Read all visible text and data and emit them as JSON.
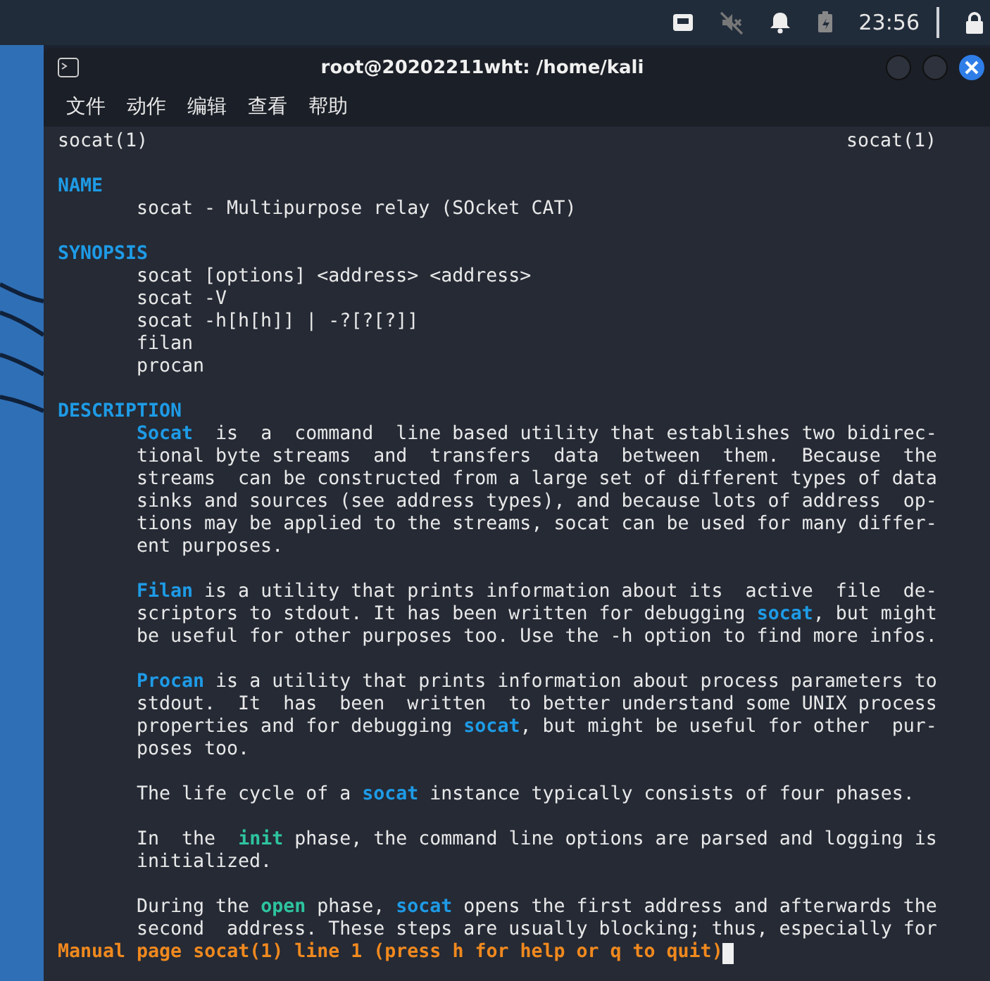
{
  "panel": {
    "clock": "23:56"
  },
  "window": {
    "title": "root@20202211wht: /home/kali"
  },
  "menu": [
    "文件",
    "动作",
    "编辑",
    "查看",
    "帮助"
  ],
  "man": {
    "header_left": "socat(1)",
    "header_right": "socat(1)",
    "sections": [
      {
        "heading": "NAME",
        "paragraphs": [
          [
            [
              {
                "text": "socat - Multipurpose relay (SOcket CAT)",
                "kind": "plain"
              }
            ]
          ]
        ]
      },
      {
        "heading": "SYNOPSIS",
        "paragraphs": [
          [
            [
              {
                "text": "socat [options] <address> <address>",
                "kind": "plain"
              }
            ],
            [
              {
                "text": "socat -V",
                "kind": "plain"
              }
            ],
            [
              {
                "text": "socat -h[h[h]] | -?[?[?]]",
                "kind": "plain"
              }
            ],
            [
              {
                "text": "filan",
                "kind": "plain"
              }
            ],
            [
              {
                "text": "procan",
                "kind": "plain"
              }
            ]
          ]
        ]
      },
      {
        "heading": "DESCRIPTION",
        "paragraphs": [
          [
            [
              {
                "text": "Socat",
                "kind": "command"
              },
              {
                "text": "  is  a  command  line based utility that establishes two bidirec-",
                "kind": "plain"
              }
            ],
            [
              {
                "text": "tional byte streams  and  transfers  data  between  them.  Because  the",
                "kind": "plain"
              }
            ],
            [
              {
                "text": "streams  can be constructed from a large set of different types of data",
                "kind": "plain"
              }
            ],
            [
              {
                "text": "sinks and sources (see address types), and because lots of address  op-",
                "kind": "plain"
              }
            ],
            [
              {
                "text": "tions may be applied to the streams, socat can be used for many differ-",
                "kind": "plain"
              }
            ],
            [
              {
                "text": "ent purposes.",
                "kind": "plain"
              }
            ]
          ],
          [
            [
              {
                "text": "Filan",
                "kind": "command"
              },
              {
                "text": " is a utility that prints information about its  active  file  de-",
                "kind": "plain"
              }
            ],
            [
              {
                "text": "scriptors to stdout. It has been written for debugging ",
                "kind": "plain"
              },
              {
                "text": "socat",
                "kind": "command"
              },
              {
                "text": ", but might",
                "kind": "plain"
              }
            ],
            [
              {
                "text": "be useful for other purposes too. Use the -h option to find more infos.",
                "kind": "plain"
              }
            ]
          ],
          [
            [
              {
                "text": "Procan",
                "kind": "command"
              },
              {
                "text": " is a utility that prints information about process parameters to",
                "kind": "plain"
              }
            ],
            [
              {
                "text": "stdout.  It  has  been  written  to better understand some UNIX process",
                "kind": "plain"
              }
            ],
            [
              {
                "text": "properties and for debugging ",
                "kind": "plain"
              },
              {
                "text": "socat",
                "kind": "command"
              },
              {
                "text": ", but might be useful for other  pur-",
                "kind": "plain"
              }
            ],
            [
              {
                "text": "poses too.",
                "kind": "plain"
              }
            ]
          ],
          [
            [
              {
                "text": "The life cycle of a ",
                "kind": "plain"
              },
              {
                "text": "socat",
                "kind": "command"
              },
              {
                "text": " instance typically consists of four phases.",
                "kind": "plain"
              }
            ]
          ],
          [
            [
              {
                "text": "In  the  ",
                "kind": "plain"
              },
              {
                "text": "init",
                "kind": "keyword"
              },
              {
                "text": " phase, the command line options are parsed and logging is",
                "kind": "plain"
              }
            ],
            [
              {
                "text": "initialized.",
                "kind": "plain"
              }
            ]
          ],
          [
            [
              {
                "text": "During the ",
                "kind": "plain"
              },
              {
                "text": "open",
                "kind": "keyword"
              },
              {
                "text": " phase, ",
                "kind": "plain"
              },
              {
                "text": "socat",
                "kind": "command"
              },
              {
                "text": " opens the first address and afterwards the",
                "kind": "plain"
              }
            ],
            [
              {
                "text": "second  address. These steps are usually blocking; thus, especially for",
                "kind": "plain"
              }
            ]
          ]
        ]
      }
    ],
    "status": "Manual page socat(1) line 1 (press h for help or q to quit)"
  }
}
